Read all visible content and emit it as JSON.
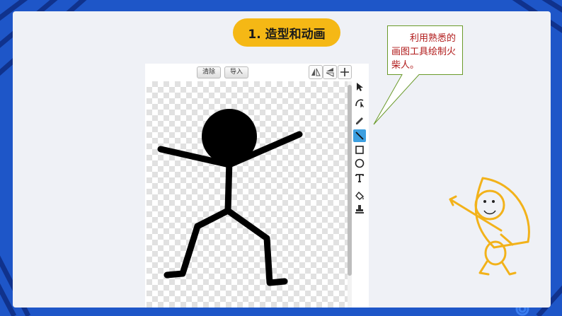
{
  "slide_title": "1. 造型和动画",
  "editor": {
    "clear_label": "清除",
    "import_label": "导入",
    "selected_tool": "line-tool"
  },
  "callout": {
    "text": "　　利用熟悉的画图工具绘制火柴人。"
  },
  "tools": [
    {
      "icon": "select-arrow-icon"
    },
    {
      "icon": "reshape-icon"
    },
    {
      "icon": "pencil-icon"
    },
    {
      "icon": "line-icon"
    },
    {
      "icon": "rectangle-icon"
    },
    {
      "icon": "ellipse-icon"
    },
    {
      "icon": "text-icon"
    },
    {
      "icon": "fill-bucket-icon"
    },
    {
      "icon": "stamp-icon"
    }
  ],
  "colors": {
    "background": "#1e56c8",
    "slide": "#eff1f6",
    "title_pill": "#f5b815",
    "callout_text": "#b01919",
    "callout_border": "#6a9a2a",
    "active_tool": "#3c9fe0",
    "archer_stroke": "#f2b21a"
  }
}
